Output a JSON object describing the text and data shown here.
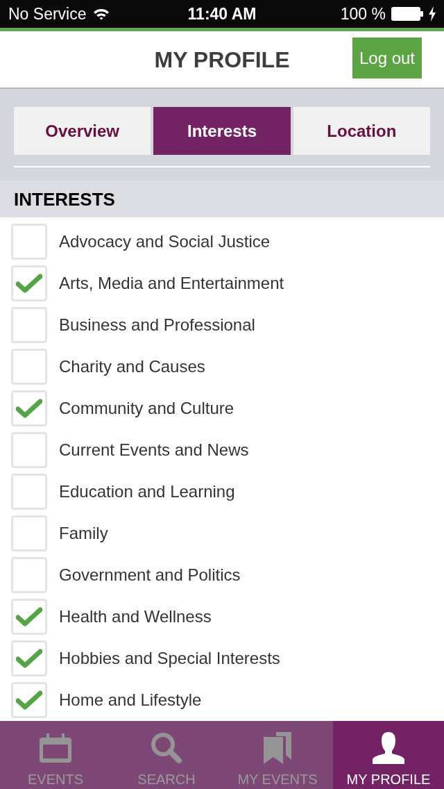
{
  "status_bar": {
    "carrier": "No Service",
    "time": "11:40 AM",
    "battery": "100 %"
  },
  "header": {
    "title": "MY PROFILE",
    "logout_button": "Log out"
  },
  "tabs": [
    {
      "label": "Overview",
      "selected": false
    },
    {
      "label": "Interests",
      "selected": true
    },
    {
      "label": "Location",
      "selected": false
    }
  ],
  "section": {
    "title": "INTERESTS"
  },
  "interests": [
    {
      "label": "Advocacy and Social Justice",
      "checked": false
    },
    {
      "label": "Arts, Media and Entertainment",
      "checked": true
    },
    {
      "label": "Business and Professional",
      "checked": false
    },
    {
      "label": "Charity and Causes",
      "checked": false
    },
    {
      "label": "Community and Culture",
      "checked": true
    },
    {
      "label": "Current Events and News",
      "checked": false
    },
    {
      "label": "Education and Learning",
      "checked": false
    },
    {
      "label": "Family",
      "checked": false
    },
    {
      "label": "Government and Politics",
      "checked": false
    },
    {
      "label": "Health and Wellness",
      "checked": true
    },
    {
      "label": "Hobbies and Special Interests",
      "checked": true
    },
    {
      "label": "Home and Lifestyle",
      "checked": true
    }
  ],
  "tab_bar": [
    {
      "label": "EVENTS",
      "selected": false
    },
    {
      "label": "SEARCH",
      "selected": false
    },
    {
      "label": "MY EVENTS",
      "selected": false
    },
    {
      "label": "MY PROFILE",
      "selected": true
    }
  ]
}
